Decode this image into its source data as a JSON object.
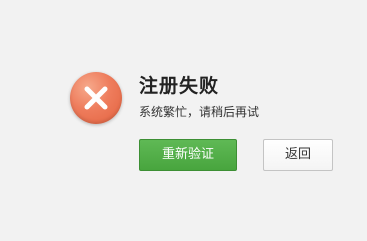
{
  "dialog": {
    "icon": "error-x-icon",
    "title": "注册失败",
    "message": "系统繁忙，请稍后再试"
  },
  "buttons": {
    "retry_label": "重新验证",
    "back_label": "返回"
  },
  "colors": {
    "background": "#f2f2f2",
    "error_icon": "#ee7c5c",
    "primary_button": "#4cae42",
    "primary_text": "#ffffff",
    "secondary_border": "#c4c4c4"
  }
}
